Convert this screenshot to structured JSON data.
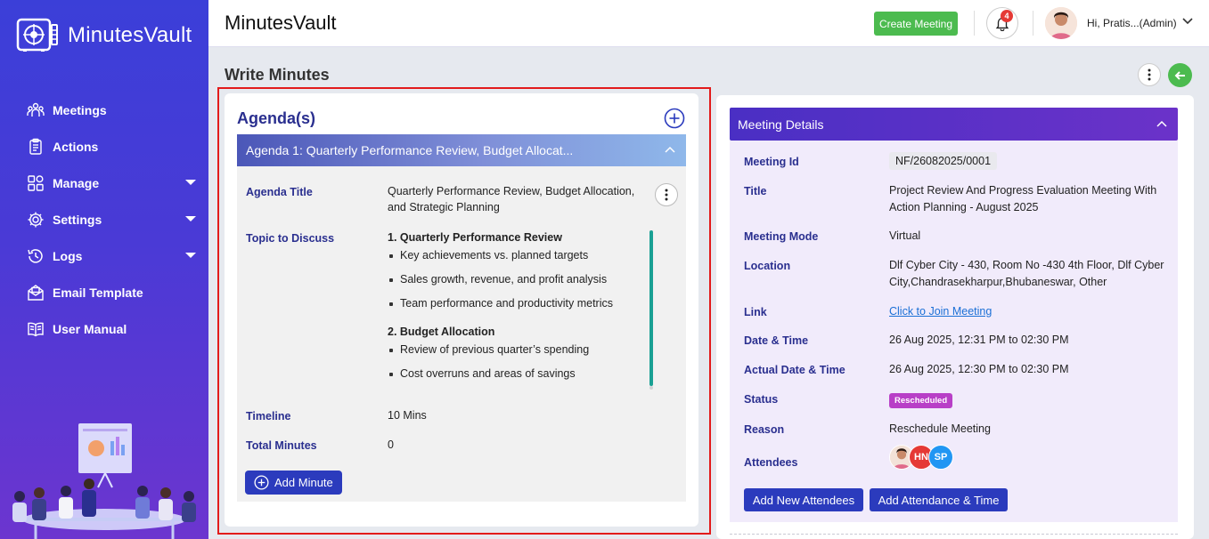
{
  "brand": {
    "name": "MinutesVault"
  },
  "sidebar": {
    "items": [
      {
        "label": "Meetings",
        "icon": "meetings-icon",
        "has_submenu": false
      },
      {
        "label": "Actions",
        "icon": "actions-icon",
        "has_submenu": false
      },
      {
        "label": "Manage",
        "icon": "manage-icon",
        "has_submenu": true
      },
      {
        "label": "Settings",
        "icon": "settings-icon",
        "has_submenu": true
      },
      {
        "label": "Logs",
        "icon": "logs-icon",
        "has_submenu": true
      },
      {
        "label": "Email Template",
        "icon": "email-icon",
        "has_submenu": false
      },
      {
        "label": "User Manual",
        "icon": "manual-icon",
        "has_submenu": false
      }
    ]
  },
  "header": {
    "title": "MinutesVault",
    "create_label": "Create Meeting",
    "notification_count": "4",
    "user_label": "Hi, Pratis...(Admin)"
  },
  "page": {
    "title": "Write Minutes"
  },
  "agenda": {
    "heading": "Agenda(s)",
    "accordion_title": "Agenda 1: Quarterly Performance Review, Budget Allocat...",
    "title_label": "Agenda Title",
    "title_value_line1": "Quarterly Performance Review, Budget Allocation,",
    "title_value_line2": "and Strategic Planning",
    "topic_label": "Topic to Discuss",
    "topics": [
      {
        "heading": "1. Quarterly Performance Review",
        "bullets": [
          "Key achievements vs. planned targets",
          "Sales growth, revenue, and profit analysis",
          "Team performance and productivity metrics"
        ]
      },
      {
        "heading": "2. Budget Allocation",
        "bullets": [
          "Review of previous quarter’s spending",
          "Cost overruns and areas of savings"
        ]
      }
    ],
    "timeline_label": "Timeline",
    "timeline_value": "10 Mins",
    "total_label": "Total Minutes",
    "total_value": "0",
    "add_minute_label": "Add Minute"
  },
  "details": {
    "heading": "Meeting Details",
    "meeting_id_label": "Meeting Id",
    "meeting_id": "NF/26082025/0001",
    "title_label": "Title",
    "title_line1": "Project Review And Progress Evaluation Meeting With",
    "title_line2": "Action Planning - August 2025",
    "mode_label": "Meeting Mode",
    "mode": "Virtual",
    "location_label": "Location",
    "location_line1": "Dlf Cyber City - 430, Room No -430 4th Floor, Dlf Cyber",
    "location_line2": "City,Chandrasekharpur,Bhubaneswar, Other",
    "link_label": "Link",
    "link_text": "Click to Join Meeting",
    "datetime_label": "Date & Time",
    "datetime": "26 Aug 2025, 12:31 PM to 02:30 PM",
    "actual_label": "Actual Date & Time",
    "actual": "26 Aug 2025, 12:30 PM to 02:30 PM",
    "status_label": "Status",
    "status": "Rescheduled",
    "reason_label": "Reason",
    "reason": "Reschedule Meeting",
    "attendees_label": "Attendees",
    "attendees": [
      {
        "initials": "",
        "color": "#f3d6c8"
      },
      {
        "initials": "HN",
        "color": "#e53935"
      },
      {
        "initials": "SP",
        "color": "#2196f3"
      }
    ],
    "add_attendees_label": "Add New Attendees",
    "add_attendance_label": "Add Attendance & Time"
  },
  "colors": {
    "accent_blue": "#2b3bbd",
    "label_blue": "#2a2f8f",
    "green": "#4cbb4f",
    "badge_red": "#e53935",
    "highlight_red": "#e21b1b"
  }
}
